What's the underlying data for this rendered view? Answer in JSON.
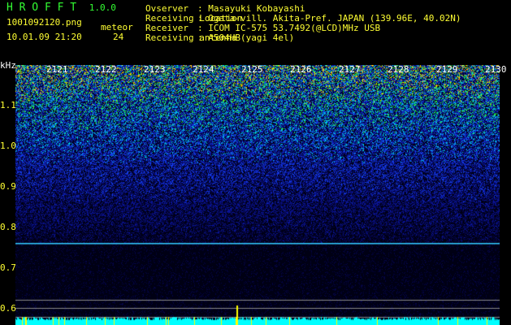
{
  "app": {
    "title": "H R O F F T",
    "version": "1.0.0"
  },
  "file": {
    "name": "1001092120.png",
    "datetime": "10.01.09 21:20"
  },
  "meteor": {
    "label": "meteor",
    "count": "24"
  },
  "info": [
    {
      "label": "Ovserver",
      "value": ": Masayuki Kobayashi"
    },
    {
      "label": "Receiving Location",
      "value": ": Ogata-vill. Akita-Pref. JAPAN (139.96E, 40.02N)"
    },
    {
      "label": "Receiver",
      "value": ": ICOM IC-575 53.7492(@LCD)MHz USB"
    },
    {
      "label": "Receiving antenna",
      "value": ": A504HB(yagi 4el)"
    }
  ],
  "axis": {
    "unit": "kHz",
    "y_labels": [
      "1.1",
      "1.0",
      "0.9",
      "0.8",
      "0.7",
      "0.6"
    ],
    "time_labels": [
      "2121",
      "2122",
      "2123",
      "2124",
      "2125",
      "2126",
      "2127",
      "2128",
      "2129",
      "2130"
    ]
  },
  "colors": {
    "text": "#ffff33",
    "title": "#33ff33",
    "carrier": "#33ccff",
    "bar": "#00ffff"
  }
}
